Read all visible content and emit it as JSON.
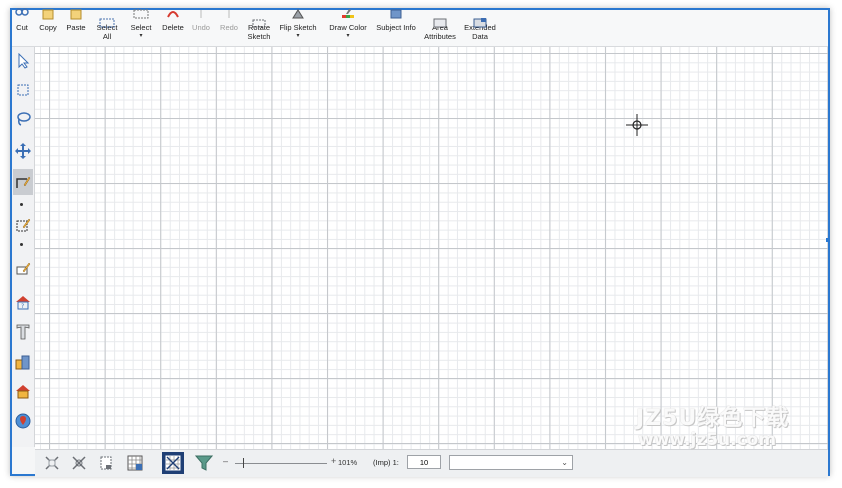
{
  "toolbar": {
    "buttons": [
      {
        "label": "Cut",
        "icon": "scissors-icon"
      },
      {
        "label": "Copy",
        "icon": "copy-icon"
      },
      {
        "label": "Paste",
        "icon": "paste-icon"
      },
      {
        "label": "Select\nAll",
        "icon": "select-all-icon"
      },
      {
        "label": "Select",
        "icon": "select-icon",
        "dropdown": true
      },
      {
        "label": "Delete",
        "icon": "delete-icon"
      },
      {
        "label": "Undo",
        "icon": "undo-icon",
        "disabled": true
      },
      {
        "label": "Redo",
        "icon": "redo-icon",
        "disabled": true
      },
      {
        "label": "Rotate\nSketch",
        "icon": "rotate-sketch-icon"
      },
      {
        "label": "Flip Sketch",
        "icon": "flip-sketch-icon",
        "dropdown": true
      },
      {
        "label": "Draw Color",
        "icon": "draw-color-icon",
        "dropdown": true
      },
      {
        "label": "Subject Info",
        "icon": "subject-info-icon"
      },
      {
        "label": "Area\nAttributes",
        "icon": "area-attributes-icon"
      },
      {
        "label": "Extended\nData",
        "icon": "extended-data-icon"
      }
    ]
  },
  "left_tools": [
    "pointer-arrow-icon",
    "rectangle-select-icon",
    "lasso-select-icon",
    "move-pan-icon",
    "draw-line-tool-icon",
    "draw-area-tool-icon",
    "edit-segment-icon",
    "house-info-icon",
    "text-tool-icon",
    "building-stack-icon",
    "house-icon",
    "map-globe-icon"
  ],
  "bottom": {
    "icons": [
      "fit-to-window-icon",
      "zoom-extents-icon",
      "page-view-icon",
      "grid-icon",
      "grid-snap-icon",
      "filter-icon"
    ],
    "zoom_minus": "–",
    "zoom_plus": "+",
    "zoom_percent": "101%",
    "scale_label": "(Imp) 1:",
    "scale_value": "10",
    "layer_value": ""
  },
  "watermark": {
    "line1": "JZ5U绿色下载",
    "line2": "www.jz5u.com"
  },
  "colors": {
    "accent": "#2b78d0",
    "active_tool": "#1f3f75",
    "grid_major": "#c4c7cb",
    "grid_minor": "#e7e9ec"
  }
}
